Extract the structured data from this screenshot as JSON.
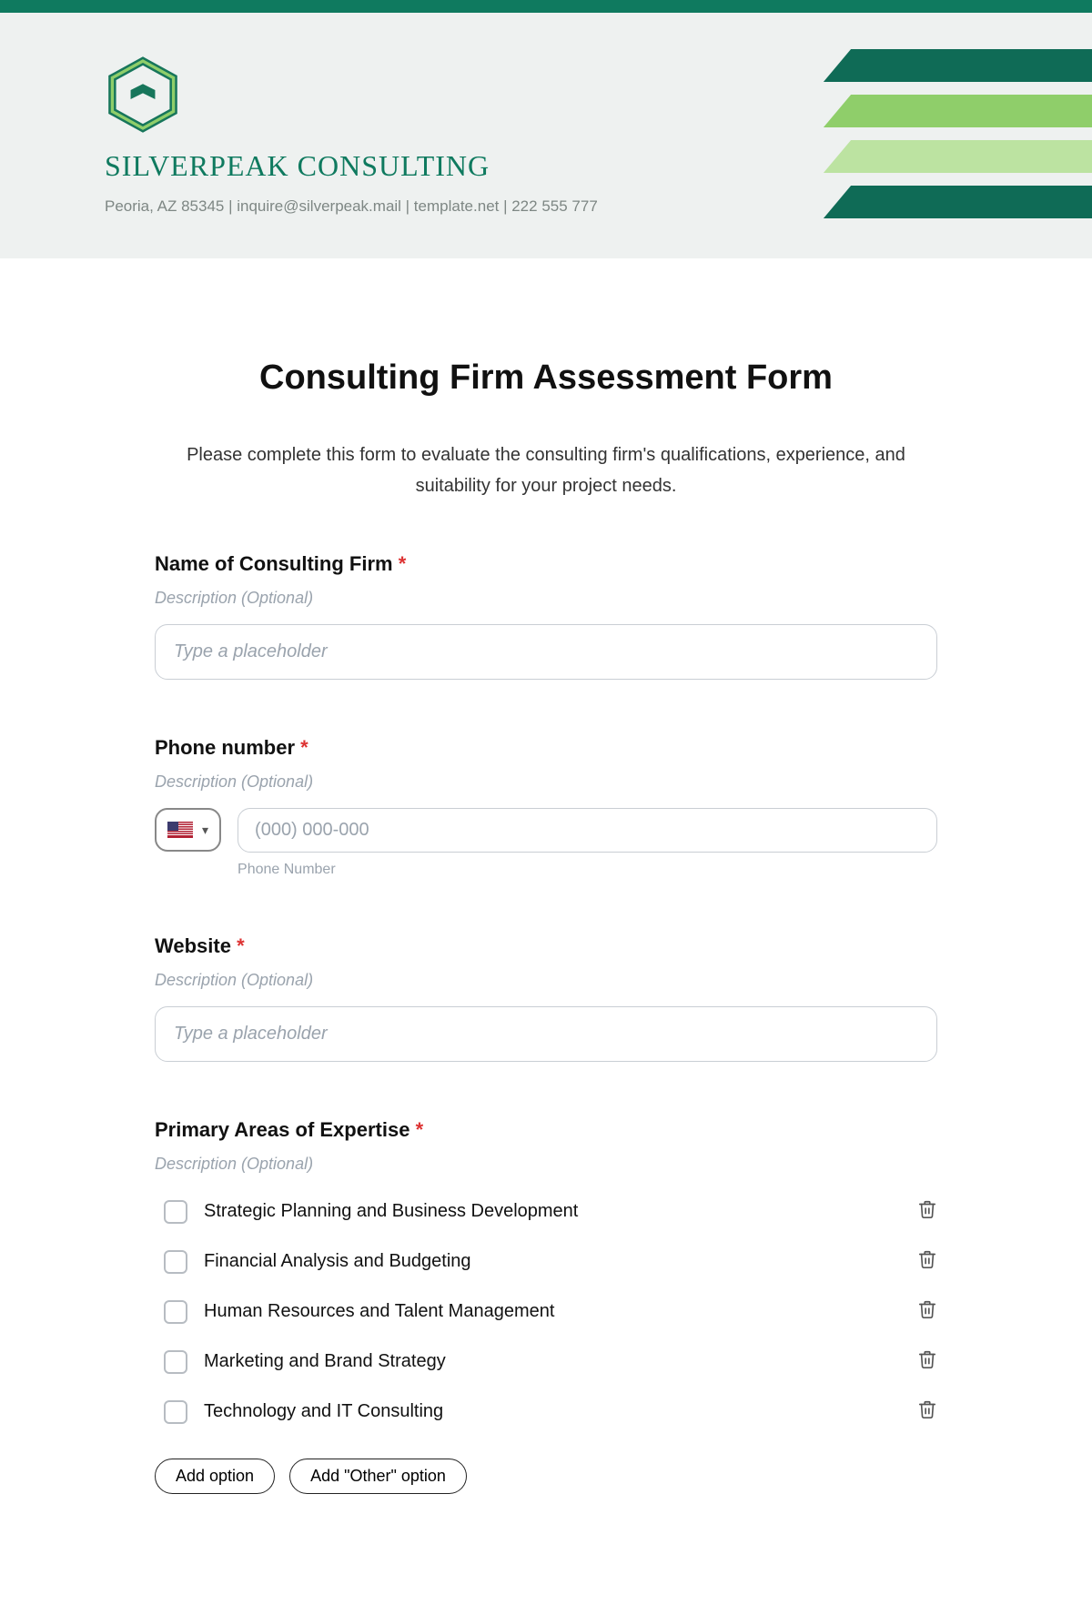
{
  "header": {
    "brand_name": "SilverPeak Consulting",
    "contact_line": "Peoria, AZ 85345 | inquire@silverpeak.mail | template.net | 222 555 777"
  },
  "form": {
    "title": "Consulting Firm Assessment Form",
    "intro": "Please complete this form to evaluate the consulting firm's qualifications, experience, and suitability for your project needs.",
    "desc_placeholder": "Description (Optional)",
    "placeholder_generic": "Type a placeholder",
    "required_mark": "*",
    "fields": {
      "firm_name": {
        "label": "Name of Consulting Firm"
      },
      "phone": {
        "label": "Phone number",
        "placeholder": "(000) 000-000",
        "sub_label": "Phone Number"
      },
      "website": {
        "label": "Website"
      },
      "expertise": {
        "label": "Primary Areas of Expertise",
        "options": [
          "Strategic Planning and Business Development",
          "Financial Analysis and Budgeting",
          "Human Resources and Talent Management",
          "Marketing and Brand Strategy",
          "Technology and IT Consulting"
        ],
        "add_option_label": "Add option",
        "add_other_label": "Add \"Other\" option"
      }
    }
  }
}
